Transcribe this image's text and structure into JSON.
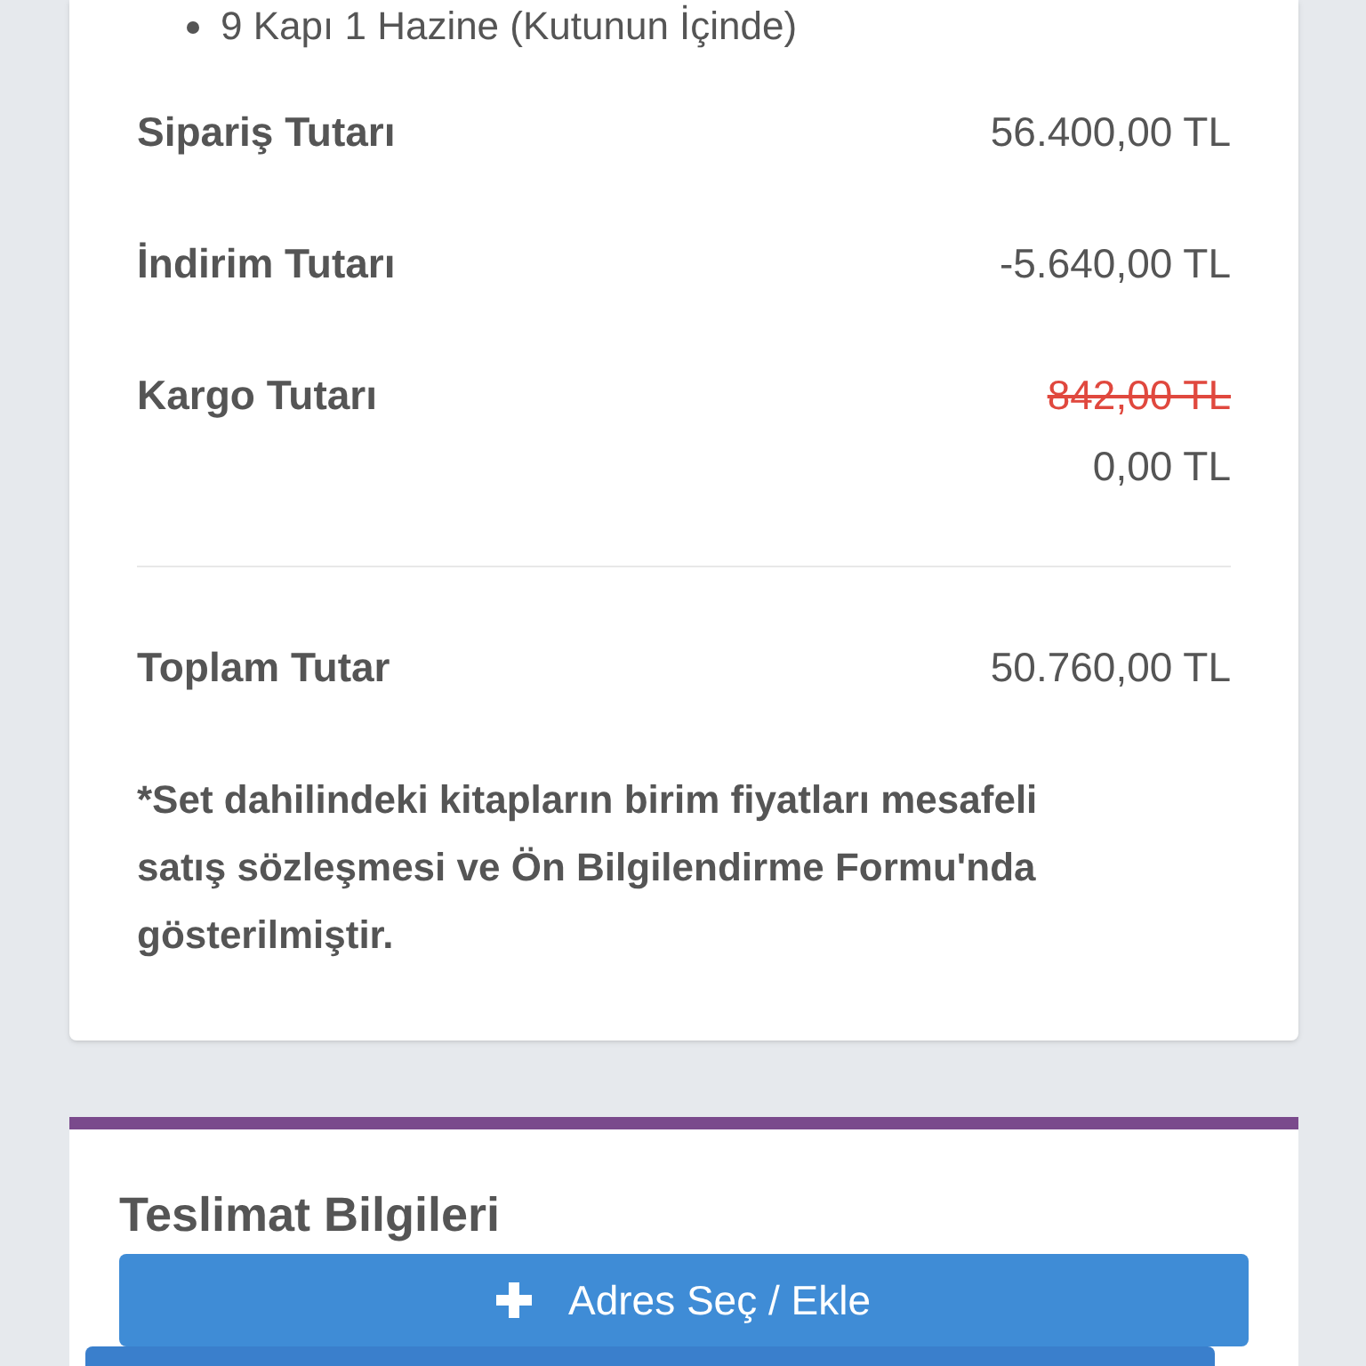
{
  "contents": [
    "9 Kapı 1 Hazine (Kutunun İçinde)"
  ],
  "summary": [
    {
      "label": "Sipariş Tutarı",
      "values": [
        {
          "text": "56.400,00 TL",
          "struck": false
        }
      ]
    },
    {
      "label": "İndirim Tutarı",
      "values": [
        {
          "text": "-5.640,00 TL",
          "struck": false
        }
      ]
    },
    {
      "label": "Kargo Tutarı",
      "values": [
        {
          "text": "842,00 TL",
          "struck": true
        },
        {
          "text": "0,00 TL",
          "struck": false
        }
      ]
    }
  ],
  "total": {
    "label": "Toplam Tutar",
    "value": "50.760,00 TL"
  },
  "note": "*Set dahilindeki kitapların birim fiyatları mesafeli satış sözleşmesi ve Ön Bilgilendirme Formu'nda gösterilmiştir.",
  "delivery": {
    "title": "Teslimat Bilgileri",
    "button": "Adres Seç / Ekle"
  }
}
